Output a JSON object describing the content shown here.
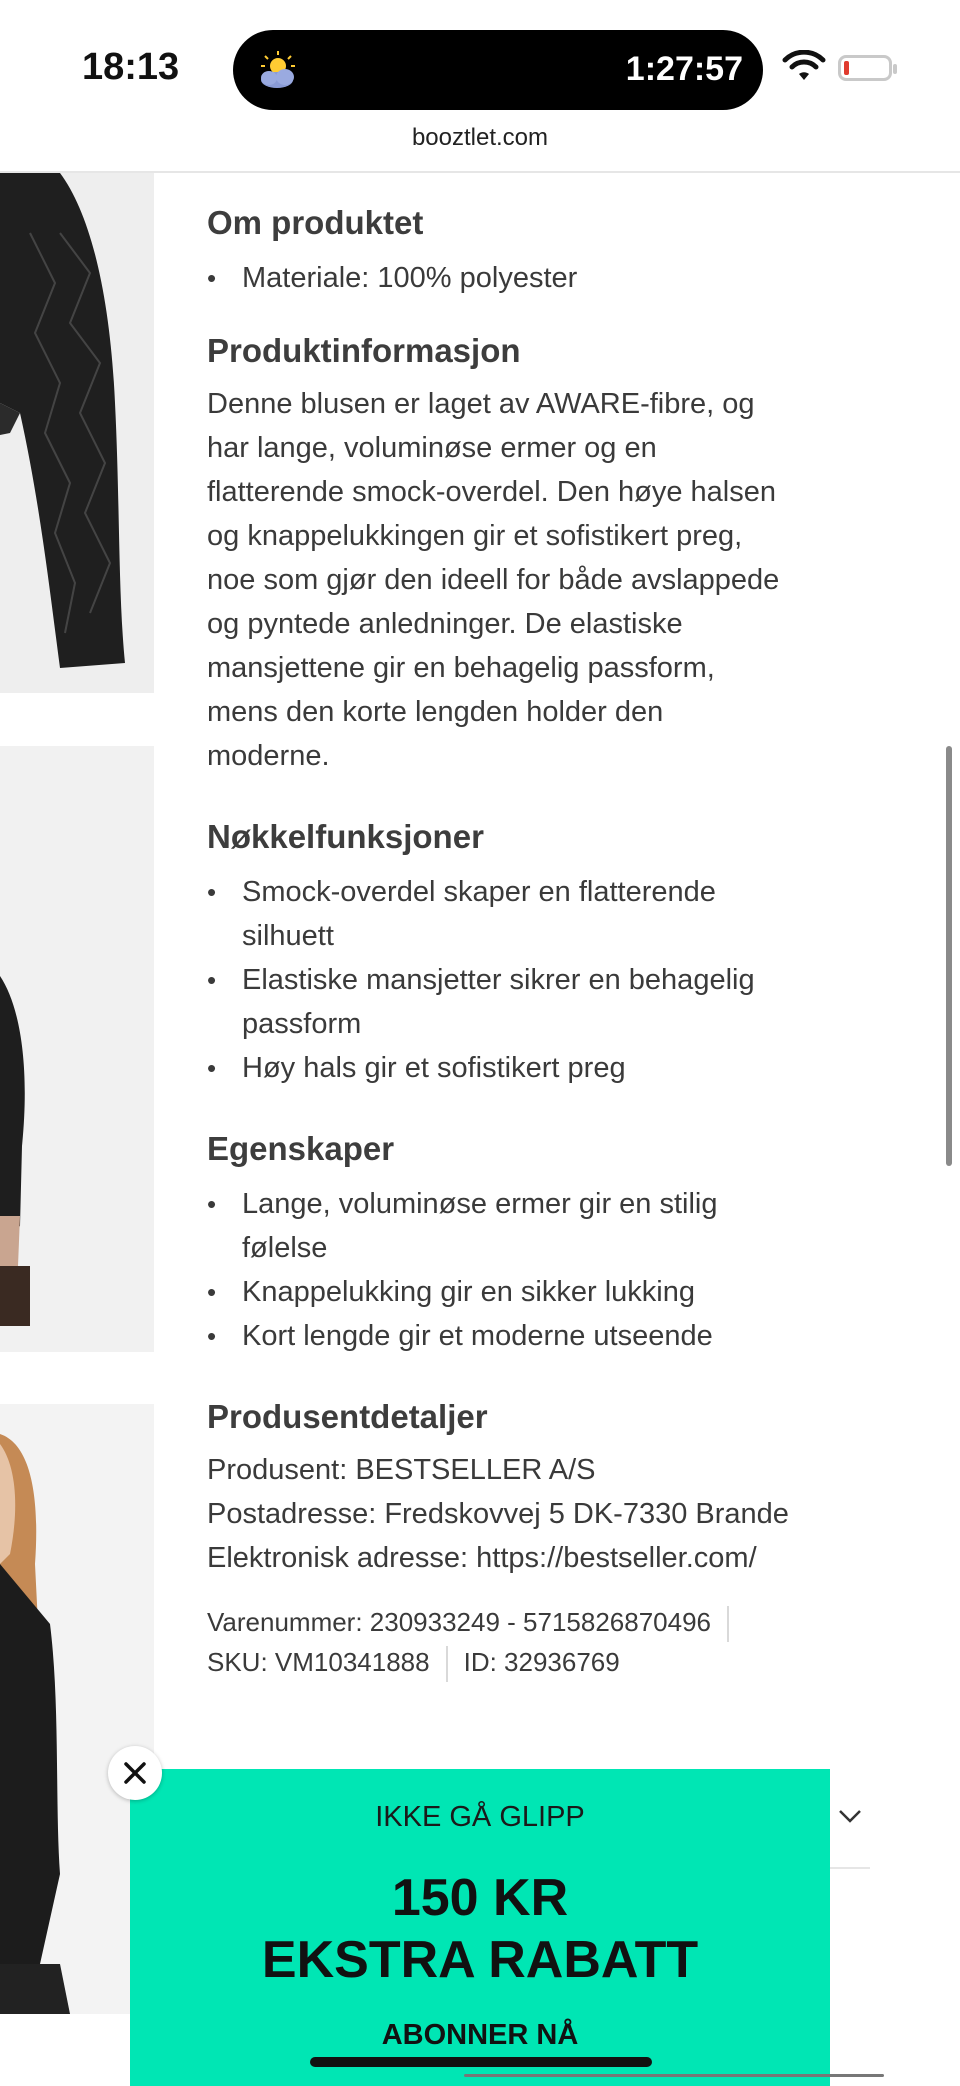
{
  "status_bar": {
    "time": "18:13",
    "island_timer": "1:27:57"
  },
  "browser": {
    "url": "booztlet.com"
  },
  "about": {
    "heading": "Om produktet",
    "items": [
      "Materiale: 100% polyester"
    ]
  },
  "product_info": {
    "heading": "Produktinformasjon",
    "lines": [
      "Denne blusen er laget av AWARE-fibre, og",
      "har lange, voluminøse ermer og en",
      "flatterende smock-overdel. Den høye halsen",
      "og knappelukkingen gir et sofistikert preg,",
      "noe som gjør den ideell for både avslappede",
      "og pyntede anledninger. De elastiske",
      "mansjettene gir en behagelig passform,",
      "mens den korte lengden holder den",
      "moderne."
    ]
  },
  "key_features": {
    "heading": "Nøkkelfunksjoner",
    "items": [
      {
        "l1": "Smock-overdel skaper en flatterende",
        "l2": "silhuett"
      },
      {
        "l1": "Elastiske mansjetter sikrer en behagelig",
        "l2": "passform"
      },
      {
        "l1": "Høy hals gir et sofistikert preg",
        "l2": ""
      }
    ]
  },
  "properties": {
    "heading": "Egenskaper",
    "items": [
      {
        "l1": "Lange, voluminøse ermer gir en stilig",
        "l2": "følelse"
      },
      {
        "l1": "Knappelukking gir en sikker lukking",
        "l2": ""
      },
      {
        "l1": "Kort lengde gir et moderne utseende",
        "l2": ""
      }
    ]
  },
  "manufacturer": {
    "heading": "Produsentdetaljer",
    "producer": "Produsent: BESTSELLER A/S",
    "address": "Postadresse: Fredskovvej 5 DK-7330 Brande",
    "web": "Elektronisk adresse: https://bestseller.com/"
  },
  "ids": {
    "item_number": "Varenummer: 230933249 - 5715826870496",
    "sku": "SKU: VM10341888",
    "id": "ID: 32936769"
  },
  "promo": {
    "pre": "IKKE GÅ GLIPP",
    "big1": "150 KR",
    "big2": "EKSTRA RABATT",
    "cta": "ABONNER NÅ",
    "bg_color": "#00e6b4"
  },
  "icons": [
    "weather-icon",
    "wifi-icon",
    "battery-icon",
    "close-icon",
    "chevron-down-icon"
  ]
}
